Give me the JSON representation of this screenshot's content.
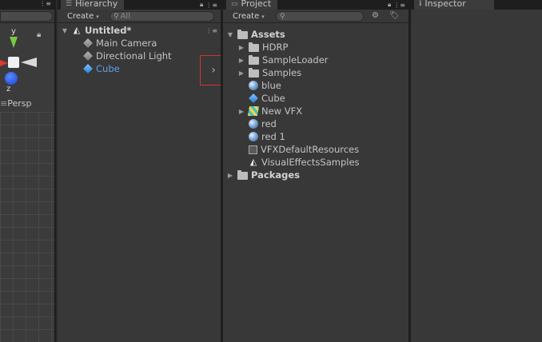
{
  "scene": {
    "persp_label": "Persp",
    "axis_y": "y",
    "axis_z": "z"
  },
  "hierarchy": {
    "tab_label": "Hierarchy",
    "create_label": "Create",
    "search_placeholder": "All",
    "scene_name": "Untitled*",
    "items": [
      {
        "label": "Main Camera",
        "icon": "gameobject-icon"
      },
      {
        "label": "Directional Light",
        "icon": "gameobject-icon"
      },
      {
        "label": "Cube",
        "icon": "cube-icon",
        "selected_color": "#5f9fe8"
      }
    ],
    "expand_chevron": "›"
  },
  "project": {
    "tab_label": "Project",
    "create_label": "Create",
    "search_placeholder": "",
    "root": "Assets",
    "items": [
      {
        "label": "HDRP",
        "type": "folder",
        "expandable": true
      },
      {
        "label": "SampleLoader",
        "type": "folder",
        "expandable": true
      },
      {
        "label": "Samples",
        "type": "folder",
        "expandable": true
      },
      {
        "label": "blue",
        "type": "material",
        "expandable": false
      },
      {
        "label": "Cube",
        "type": "prefab",
        "expandable": false
      },
      {
        "label": "New VFX",
        "type": "vfx",
        "expandable": true
      },
      {
        "label": "red",
        "type": "material",
        "expandable": false
      },
      {
        "label": "red 1",
        "type": "material",
        "expandable": false
      },
      {
        "label": "VFXDefaultResources",
        "type": "asset",
        "expandable": false
      },
      {
        "label": "VisualEffectsSamples",
        "type": "unity",
        "expandable": false
      }
    ],
    "packages": "Packages"
  },
  "inspector": {
    "tab_label": "Inspector"
  },
  "colors": {
    "panel_bg": "#383838",
    "selection_text": "#5f9fe8",
    "highlight_box": "#d8322e"
  }
}
